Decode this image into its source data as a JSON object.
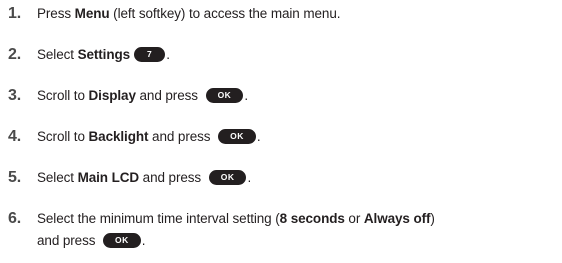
{
  "steps": [
    {
      "num": "1.",
      "parts": {
        "a": "Press ",
        "b": "Menu",
        "c": " (left softkey) to access the main menu."
      }
    },
    {
      "num": "2.",
      "parts": {
        "a": "Select ",
        "b": "Settings",
        "key": "7",
        "c": "."
      }
    },
    {
      "num": "3.",
      "parts": {
        "a": "Scroll to ",
        "b": "Display",
        "c": " and press ",
        "key": "OK",
        "d": "."
      }
    },
    {
      "num": "4.",
      "parts": {
        "a": "Scroll to ",
        "b": "Backlight",
        "c": " and press ",
        "key": "OK",
        "d": "."
      }
    },
    {
      "num": "5.",
      "parts": {
        "a": "Select ",
        "b": "Main LCD",
        "c": " and press ",
        "key": "OK",
        "d": "."
      }
    },
    {
      "num": "6.",
      "parts": {
        "a": "Select the minimum time interval setting (",
        "b": "8 seconds",
        "c": " or ",
        "d": "Always off",
        "e": ")",
        "f": "and press ",
        "key": "OK",
        "g": "."
      }
    }
  ],
  "colors": {
    "text": "#231f20",
    "number": "#4a4a4a",
    "key_background": "#231f20",
    "key_text": "#ffffff"
  }
}
